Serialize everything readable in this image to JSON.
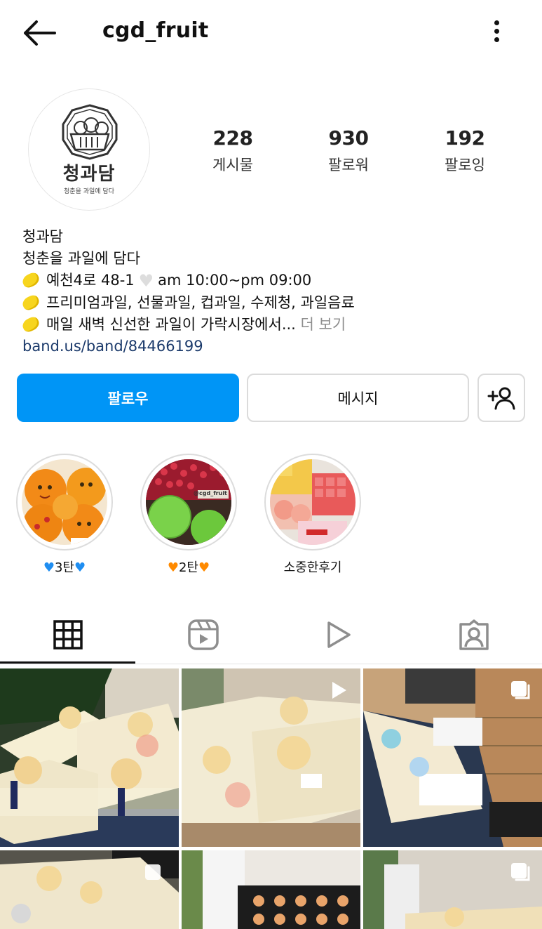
{
  "header": {
    "username": "cgd_fruit"
  },
  "avatar": {
    "title": "청과담",
    "subtitle": "청춘을 과일에 담다"
  },
  "stats": [
    {
      "num": "228",
      "label": "게시물"
    },
    {
      "num": "930",
      "label": "팔로워"
    },
    {
      "num": "192",
      "label": "팔로잉"
    }
  ],
  "bio": {
    "name": "청과담",
    "tagline": "청춘을 과일에 담다",
    "address": "예천4로 48-1",
    "hours": "am 10:00~pm 09:00",
    "products": "프리미엄과일, 선물과일, 컵과일, 수제청, 과일음료",
    "daily": "매일 새벽 신선한 과일이 가락시장에서...",
    "more": "더 보기",
    "link": "band.us/band/84466199"
  },
  "actions": {
    "follow": "팔로우",
    "message": "메시지"
  },
  "highlights": [
    {
      "label": "3탄",
      "heart": "💙"
    },
    {
      "label": "2탄",
      "heart": "🧡"
    },
    {
      "label": "소중한후기",
      "heart": ""
    }
  ],
  "highlight_texts": {
    "watermark": "@cgd_fruit"
  },
  "tabs": [
    "grid-icon",
    "reels-icon",
    "play-icon",
    "tagged-icon"
  ],
  "colors": {
    "accent": "#0095f6",
    "link": "#1b3a6b",
    "muted": "#8e8e8e"
  },
  "grid": {
    "posts": [
      {
        "type": "photo"
      },
      {
        "type": "video"
      },
      {
        "type": "carousel"
      },
      {
        "type": "photo"
      },
      {
        "type": "photo"
      },
      {
        "type": "carousel"
      }
    ]
  }
}
